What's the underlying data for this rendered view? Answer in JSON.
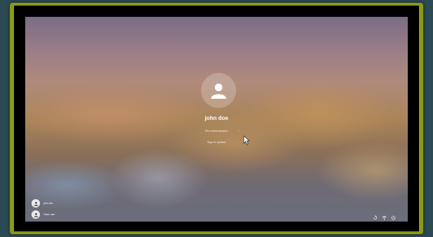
{
  "lock_screen": {
    "username": "john doe",
    "pin_link": "PIN Authentication",
    "pin_chevron": "›",
    "sign_in_options": "Sign-in options"
  },
  "user_switcher": {
    "users": [
      {
        "label": "john doe",
        "icon": "user-icon"
      },
      {
        "label": "Other user",
        "icon": "user-icon"
      }
    ]
  },
  "system_icons": [
    "accessibility-icon",
    "network-icon",
    "power-icon"
  ],
  "colors": {
    "bezel": "#8a9a17",
    "backdrop": "#2c4a54"
  }
}
